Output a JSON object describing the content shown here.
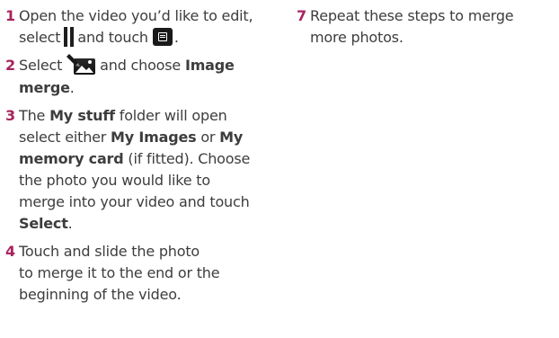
{
  "steps_left": [
    {
      "number": "1",
      "l1": "Open the video you’d like to edit,",
      "l2_pre": "select",
      "l2_mid": "and touch",
      "l2_post": "."
    },
    {
      "number": "2",
      "l1_pre": "Select",
      "l1_mid": "and choose",
      "l1_bold": "Image",
      "l2_bold": "merge",
      "l2_post": "."
    },
    {
      "number": "3",
      "l1_pre": "The",
      "l1_bold": "My stuff",
      "l1_post": "folder will open",
      "l2_pre": "select either",
      "l2_bold1": "My Images",
      "l2_mid": "or",
      "l2_bold2": "My",
      "l3_bold": "memory card",
      "l3_post": "(if fitted). Choose",
      "l4": "the photo you would like to",
      "l5": "merge into your video and touch",
      "l6_bold": "Select",
      "l6_post": "."
    },
    {
      "number": "4",
      "l1": "Touch and slide the photo",
      "l2": "to merge it to the end or the",
      "l3": "beginning of the video."
    }
  ],
  "steps_right": [
    {
      "number": "7",
      "l1": "Repeat these steps to merge",
      "l2": "more photos."
    }
  ],
  "colors": {
    "accent": "#a8235e",
    "text": "#3d3d3d",
    "icon_dark": "#1a1a1a"
  },
  "icons": [
    "pause-icon",
    "menu-icon",
    "image-edit-icon"
  ]
}
